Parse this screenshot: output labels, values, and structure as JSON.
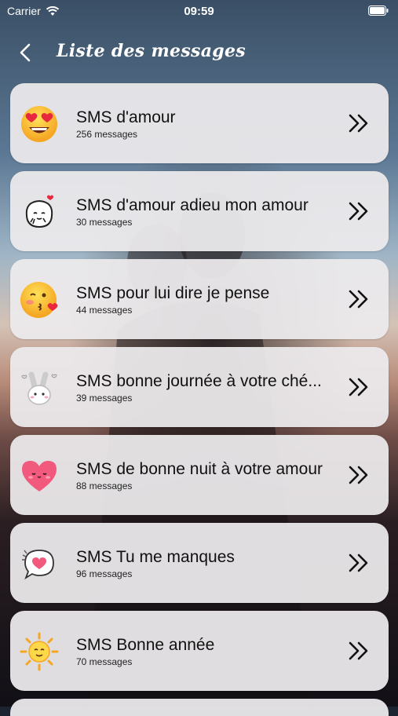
{
  "status": {
    "carrier": "Carrier",
    "time": "09:59"
  },
  "nav": {
    "title": "Liste des messages"
  },
  "items": [
    {
      "label": "SMS d'amour",
      "count": "256 messages",
      "icon": "heart-eyes-emoji-icon"
    },
    {
      "label": "SMS d'amour adieu mon amour",
      "count": "30 messages",
      "icon": "cute-sticker-icon"
    },
    {
      "label": "SMS pour lui dire je pense",
      "count": "44 messages",
      "icon": "kissing-emoji-icon"
    },
    {
      "label": "SMS bonne journée à votre ché...",
      "count": "39 messages",
      "icon": "bunny-sticker-icon"
    },
    {
      "label": "SMS de bonne nuit à votre amour",
      "count": "88 messages",
      "icon": "pink-heart-icon"
    },
    {
      "label": "SMS Tu me manques",
      "count": "96 messages",
      "icon": "heart-speech-bubble-icon"
    },
    {
      "label": "SMS Bonne année",
      "count": "70 messages",
      "icon": "sun-icon"
    }
  ]
}
